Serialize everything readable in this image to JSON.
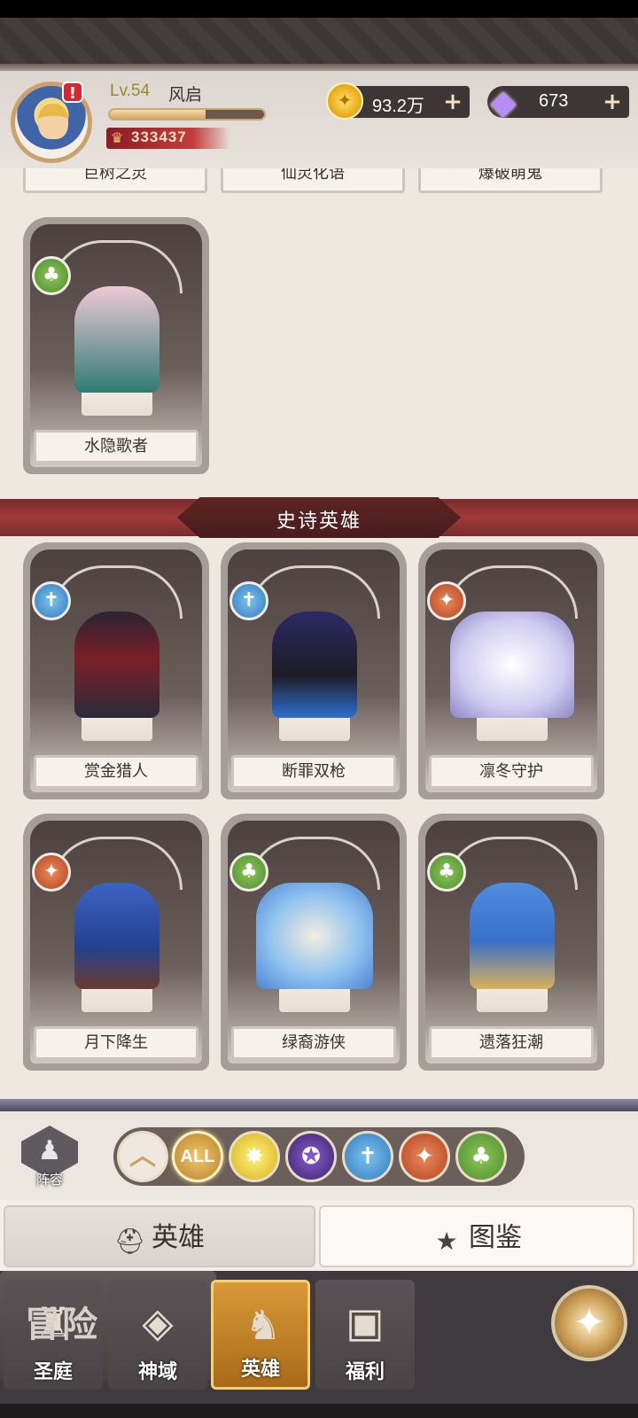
{
  "player": {
    "level": "Lv.54",
    "name": "风启",
    "power": "333437",
    "xp_fraction": 0.62,
    "alert": "!"
  },
  "currencies": {
    "gold": "93.2万",
    "gems": "673",
    "plus": "+"
  },
  "partial_row": [
    "巨树之灵",
    "仙灵化语",
    "爆破萌鬼"
  ],
  "rare_heroes": [
    {
      "name": "水隐歌者",
      "faction": "nature"
    }
  ],
  "epic_section": {
    "title": "史诗英雄"
  },
  "epic_heroes": [
    {
      "name": "赏金猎人",
      "faction": "holy"
    },
    {
      "name": "断罪双枪",
      "faction": "holy"
    },
    {
      "name": "凛冬守护",
      "faction": "beast"
    },
    {
      "name": "月下降生",
      "faction": "beast"
    },
    {
      "name": "绿裔游侠",
      "faction": "nature"
    },
    {
      "name": "遗落狂潮",
      "faction": "nature"
    }
  ],
  "filter": {
    "lineup_label": "阵容",
    "all_label": "ALL",
    "options": [
      "all",
      "light",
      "dark",
      "holy",
      "beast",
      "nature"
    ],
    "selected": "all"
  },
  "tabs": {
    "heroes": "英雄",
    "codex": "图鉴"
  },
  "nav": {
    "court": "圣庭",
    "domain": "神域",
    "heroes": "英雄",
    "welfare": "福利",
    "adventure": "冒险",
    "active": "heroes"
  }
}
